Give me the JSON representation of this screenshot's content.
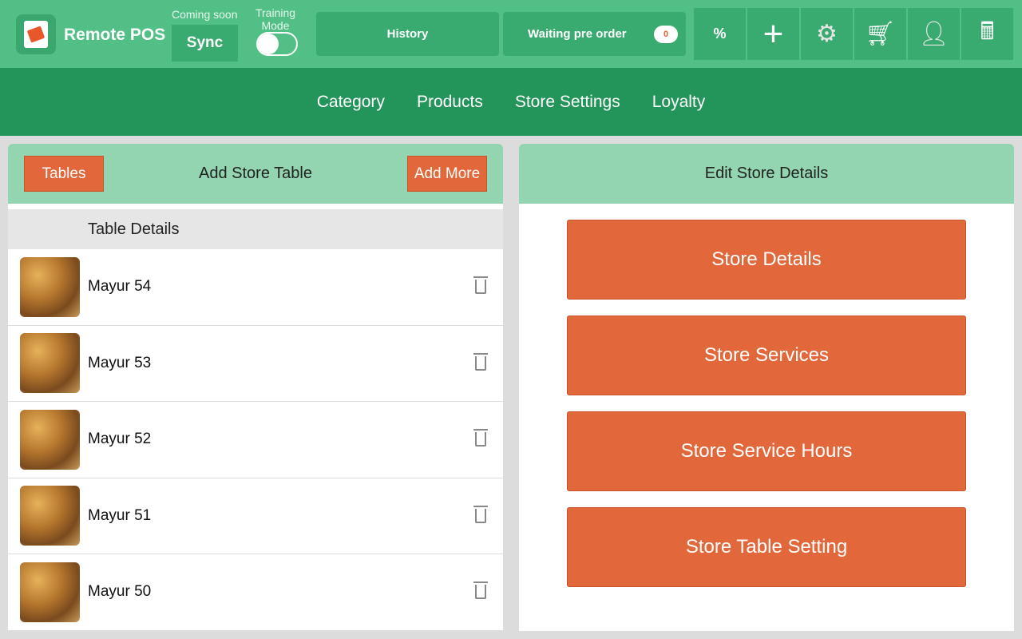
{
  "header": {
    "brand": "Remote POS",
    "coming_soon": "Coming soon",
    "sync": "Sync",
    "training_mode": "Training Mode",
    "history": "History",
    "waiting_pre_order": "Waiting pre order",
    "waiting_count": "0",
    "icons": [
      "discount-icon",
      "plus-icon",
      "gear-icon",
      "cart-icon",
      "user-icon",
      "calculator-icon"
    ]
  },
  "nav": {
    "items": [
      "Category",
      "Products",
      "Store Settings",
      "Loyalty"
    ]
  },
  "left": {
    "tables_button": "Tables",
    "title": "Add Store Table",
    "add_more": "Add More",
    "subheader": "Table Details",
    "rows": [
      {
        "name": "Mayur 54"
      },
      {
        "name": "Mayur 53"
      },
      {
        "name": "Mayur 52"
      },
      {
        "name": "Mayur 51"
      },
      {
        "name": "Mayur 50"
      }
    ]
  },
  "right": {
    "title": "Edit Store Details",
    "buttons": [
      "Store Details",
      "Store Services",
      "Store Service Hours",
      "Store Table Setting"
    ]
  },
  "colors": {
    "topbar": "#52bf86",
    "nav": "#23955a",
    "accent": "#e2673a"
  }
}
